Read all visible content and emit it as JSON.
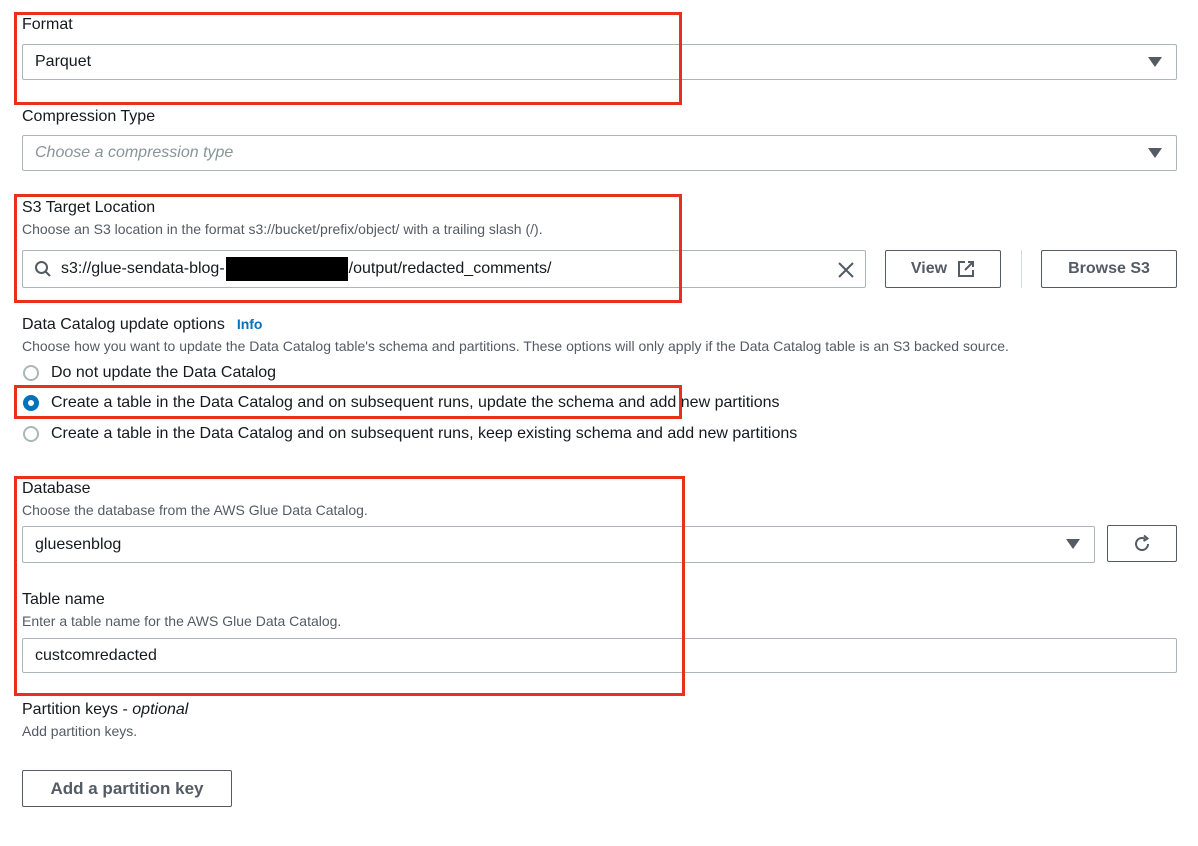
{
  "format": {
    "label": "Format",
    "value": "Parquet"
  },
  "compression": {
    "label": "Compression Type",
    "placeholder": "Choose a compression type"
  },
  "s3_target": {
    "label": "S3 Target Location",
    "description": "Choose an S3 location in the format s3://bucket/prefix/object/ with a trailing slash (/).",
    "value_prefix": "s3://glue-sendata-blog-",
    "value_suffix": "/output/redacted_comments/",
    "view_label": "View",
    "browse_label": "Browse S3"
  },
  "catalog_update": {
    "label": "Data Catalog update options",
    "info_label": "Info",
    "description": "Choose how you want to update the Data Catalog table's schema and partitions. These options will only apply if the Data Catalog table is an S3 backed source.",
    "options": [
      {
        "label": "Do not update the Data Catalog",
        "selected": false
      },
      {
        "label": "Create a table in the Data Catalog and on subsequent runs, update the schema and add new partitions",
        "selected": true
      },
      {
        "label": "Create a table in the Data Catalog and on subsequent runs, keep existing schema and add new partitions",
        "selected": false
      }
    ]
  },
  "database": {
    "label": "Database",
    "description": "Choose the database from the AWS Glue Data Catalog.",
    "value": "gluesenblog"
  },
  "table_name": {
    "label": "Table name",
    "description": "Enter a table name for the AWS Glue Data Catalog.",
    "value": "custcomredacted"
  },
  "partition_keys": {
    "label": "Partition keys - ",
    "label_optional": "optional",
    "description": "Add partition keys.",
    "add_label": "Add a partition key"
  },
  "colors": {
    "highlight": "#e8301c",
    "accent": "#0073bb"
  }
}
